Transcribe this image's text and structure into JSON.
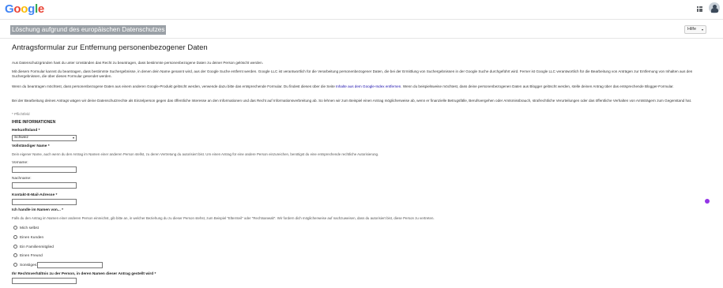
{
  "header": {
    "logo_letters": [
      {
        "ch": "G",
        "color": "#4285F4"
      },
      {
        "ch": "o",
        "color": "#EA4335"
      },
      {
        "ch": "o",
        "color": "#FBBC05"
      },
      {
        "ch": "g",
        "color": "#4285F4"
      },
      {
        "ch": "l",
        "color": "#34A853"
      },
      {
        "ch": "e",
        "color": "#EA4335"
      }
    ]
  },
  "banner": {
    "text": "Löschung aufgrund des europäischen Datenschutzes"
  },
  "help": {
    "label": "Hilfe",
    "caret": "▾"
  },
  "form": {
    "title": "Antragsformular zur Entfernung personenbezogener Daten",
    "intro": "Aus Datenschutzgründen hast du unter Umständen das Recht zu beantragen, dass bestimmte personenbezogene Daten zu deiner Person gelöscht werden.",
    "p2": "Mit diesem Formular kannst du beantragen, dass bestimmte Suchergebnisse, in denen dein Name genannt wird, aus der Google Suche entfernt werden. Google LLC ist verantwortlich für die Verarbeitung personenbezogener Daten, die bei der Ermittlung von Suchergebnissen in der Google Suche durchgeführt wird. Ferner ist Google LLC verantwortlich für die Bearbeitung von Anträgen zur Entfernung von Inhalten aus den Suchergebnissen, die über dieses Formular gesendet werden.",
    "p3_before": "Wenn du beantragen möchtest, dass personenbezogene Daten aus einem anderen Google-Produkt gelöscht werden, verwende dazu bitte das entsprechende Formular. Du findest dieses über die Seite ",
    "p3_link": "Inhalte aus dem Google-Index entfernen",
    "p3_after": ". Wenn du beispielsweise möchtest, dass deine personenbezogenen Daten aus Blogger gelöscht werden, stelle deinen Antrag über das entsprechende Blogger-Formular.",
    "p4": "Bei der Bearbeitung deines Antrags wägen wir deine Datenschutzrechte als Einzelperson gegen das öffentliche Interesse an den Informationen und das Recht auf Informationsverbreitung ab. So lehnen wir zum Beispiel einen Antrag möglicherweise ab, wenn er finanzielle Betrugsfälle, Berufsvergehen oder Amtsmissbrauch, strafrechtliche Verurteilungen oder das öffentliche Verhalten von Amtsträgern zum Gegenstand hat.",
    "required_note": "* Pflichtfeld",
    "section_title": "IHRE INFORMATIONEN",
    "country_label": "Herkunftsland *",
    "country_value": "Schweiz",
    "fullname_label": "Vollständiger Name *",
    "fullname_hint": "Dein eigener Name, auch wenn du den Antrag im Namen einer anderen Person stellst, zu deren Vertretung du autorisiert bist. Um einen Antrag für eine andere Person einzureichen, benötigst du eine entsprechende rechtliche Autorisierung.",
    "firstname_label": "Vorname:",
    "lastname_label": "Nachname:",
    "email_label": "Kontakt-E-Mail-Adresse *",
    "acting_label": "Ich handle im Namen von... *",
    "acting_hint": "Falls du den Antrag im Namen einer anderen Person einreichst, gib bitte an, in welcher Beziehung du zu dieser Person stehst, zum Beispiel \"Elternteil\" oder \"Rechtsanwalt\". Wir fordern dich möglicherweise auf nachzuweisen, dass du autorisiert bist, diese Person zu vertreten.",
    "options": [
      "Mich selbst",
      "Einen Kunden",
      "Ein Familienmitglied",
      "Einen Freund",
      "Sonstiges:"
    ],
    "relationship_label": "Ihr Rechtsverhältnis zu der Person, in deren Namen dieser Antrag gestellt wird *"
  }
}
